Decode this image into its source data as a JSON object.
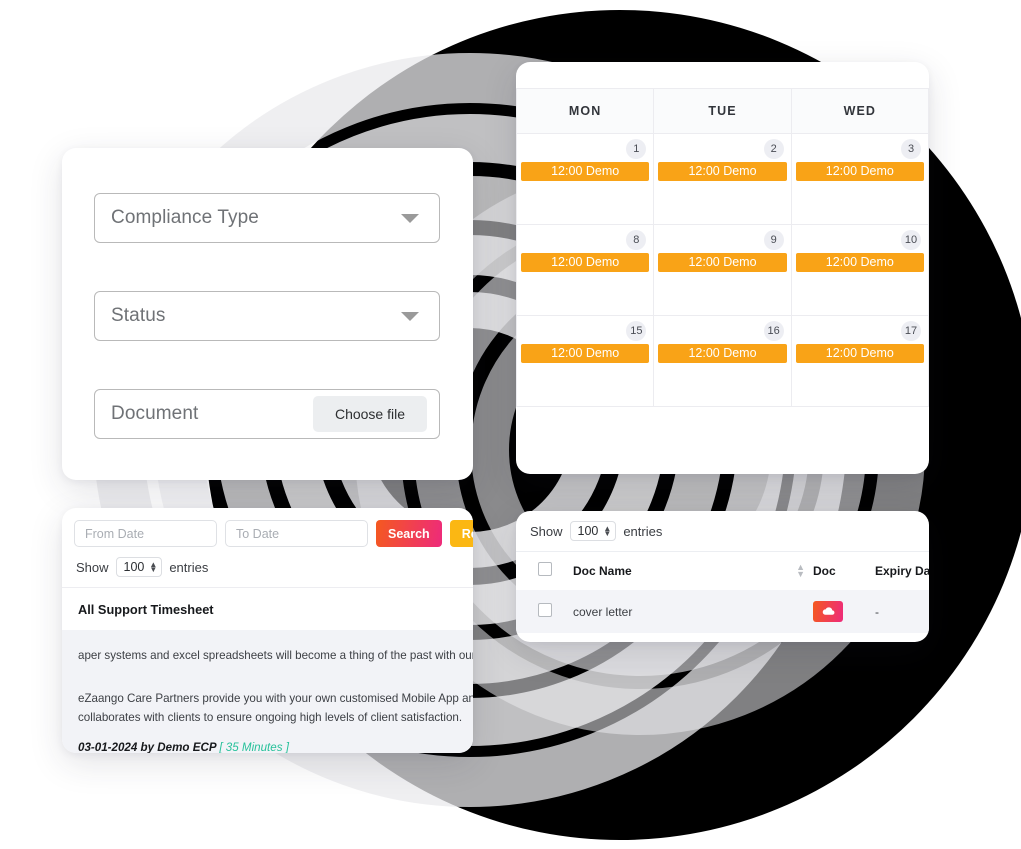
{
  "theme": {
    "accent_orange": "#f9a317",
    "accent_amber": "#fbb713",
    "gradient_start": "#f4591f",
    "gradient_end": "#ee2a7b",
    "green": "#27c19a",
    "blob_color": "#000000"
  },
  "form_card": {
    "fields": [
      {
        "label": "Compliance Type",
        "icon": "chevron-down-icon"
      },
      {
        "label": "Status",
        "icon": "chevron-down-icon"
      },
      {
        "label": "Document",
        "button_label": "Choose file"
      }
    ]
  },
  "calendar": {
    "day_headers": [
      "MON",
      "TUE",
      "WED"
    ],
    "weeks": [
      {
        "days": [
          {
            "date": "1",
            "event": "12:00 Demo"
          },
          {
            "date": "2",
            "event": "12:00 Demo"
          },
          {
            "date": "3",
            "event": "12:00 Demo"
          }
        ]
      },
      {
        "days": [
          {
            "date": "8",
            "event": "12:00 Demo"
          },
          {
            "date": "9",
            "event": "12:00 Demo"
          },
          {
            "date": "10",
            "event": "12:00 Demo"
          }
        ]
      },
      {
        "days": [
          {
            "date": "15",
            "event": "12:00 Demo"
          },
          {
            "date": "16",
            "event": "12:00 Demo"
          },
          {
            "date": "17",
            "event": "12:00 Demo"
          }
        ]
      }
    ]
  },
  "timesheet": {
    "from_date_placeholder": "From Date",
    "from_date_value": "",
    "to_date_placeholder": "To Date",
    "to_date_value": "",
    "search_label": "Search",
    "reset_label": "Reset",
    "show_label": "Show",
    "entries_value": "100",
    "entries_label": "entries",
    "title": "All Support Timesheet",
    "paragraph_1": "aper systems and excel spreadsheets will become a thing of the past with our comprehens",
    "paragraph_2_line_1": "eZaango Care Partners provide you with your own customised Mobile App and admin por",
    "paragraph_2_line_2": "collaborates with clients to ensure ongoing high levels of client satisfaction.",
    "meta_author": "03-01-2024 by Demo ECP",
    "meta_duration": "[ 35 Minutes ]"
  },
  "docs": {
    "show_label": "Show",
    "entries_value": "100",
    "entries_label": "entries",
    "columns": [
      "",
      "Doc Name",
      "Doc",
      "Expiry Date"
    ],
    "rows": [
      {
        "doc_name": "cover letter",
        "doc_icon": "cloud-download-icon",
        "expiry_date": "-"
      }
    ]
  }
}
